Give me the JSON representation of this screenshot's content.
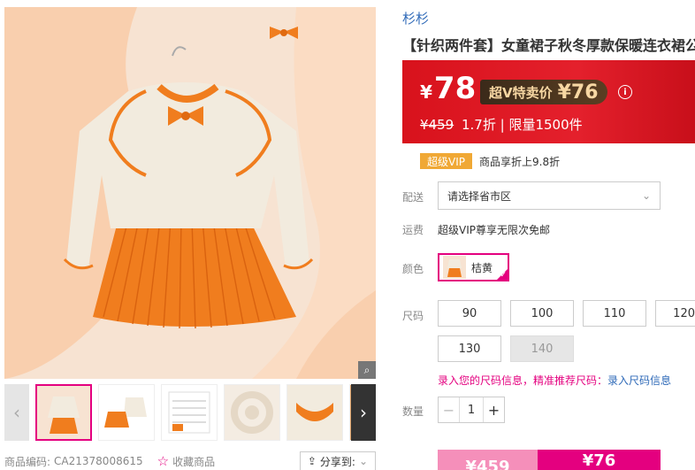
{
  "gallery": {
    "zoom_icon": "magnifier-icon",
    "arrow_left": "‹",
    "arrow_right": "›",
    "product_code_label": "商品编码:",
    "product_code": "CA21378008615",
    "favorite_label": "收藏商品",
    "share_label": "分享到:"
  },
  "product": {
    "shop_name": "杉杉",
    "title": "【针织两件套】女童裙子秋冬厚款保暖连衣裙公主裙"
  },
  "price": {
    "currency": "¥",
    "current": "78",
    "vip_label": "超V特卖价",
    "vip_price": "¥76",
    "info_icon": "i",
    "original": "¥459",
    "discount": "1.7折",
    "separator": "|",
    "limit": "限量1500件"
  },
  "vip_line": {
    "badge": "超级VIP",
    "text": "商品享折上9.8折"
  },
  "delivery": {
    "label": "配送",
    "placeholder": "请选择省市区",
    "chevron": "⌄"
  },
  "shipping": {
    "label": "运费",
    "text": "超级VIP尊享无限次免邮"
  },
  "color": {
    "label": "颜色",
    "selected": "桔黄"
  },
  "size": {
    "label": "尺码",
    "options": [
      "90",
      "100",
      "110",
      "120",
      "130",
      "140"
    ],
    "hint_pink": "录入您的尺码信息，精准推荐尺码：",
    "hint_link": "录入尺码信息"
  },
  "quantity": {
    "label": "数量",
    "minus": "−",
    "value": "1",
    "plus": "+"
  },
  "buy_bar": {
    "original_price": "¥459",
    "vip_price": "¥76"
  },
  "colors": {
    "accent_pink": "#e4007f",
    "price_red": "#d8121c",
    "vip_gold": "#f0a835",
    "link_blue": "#2f6ab8",
    "product_orange": "#f07d1e",
    "product_cream": "#f2ebde"
  }
}
